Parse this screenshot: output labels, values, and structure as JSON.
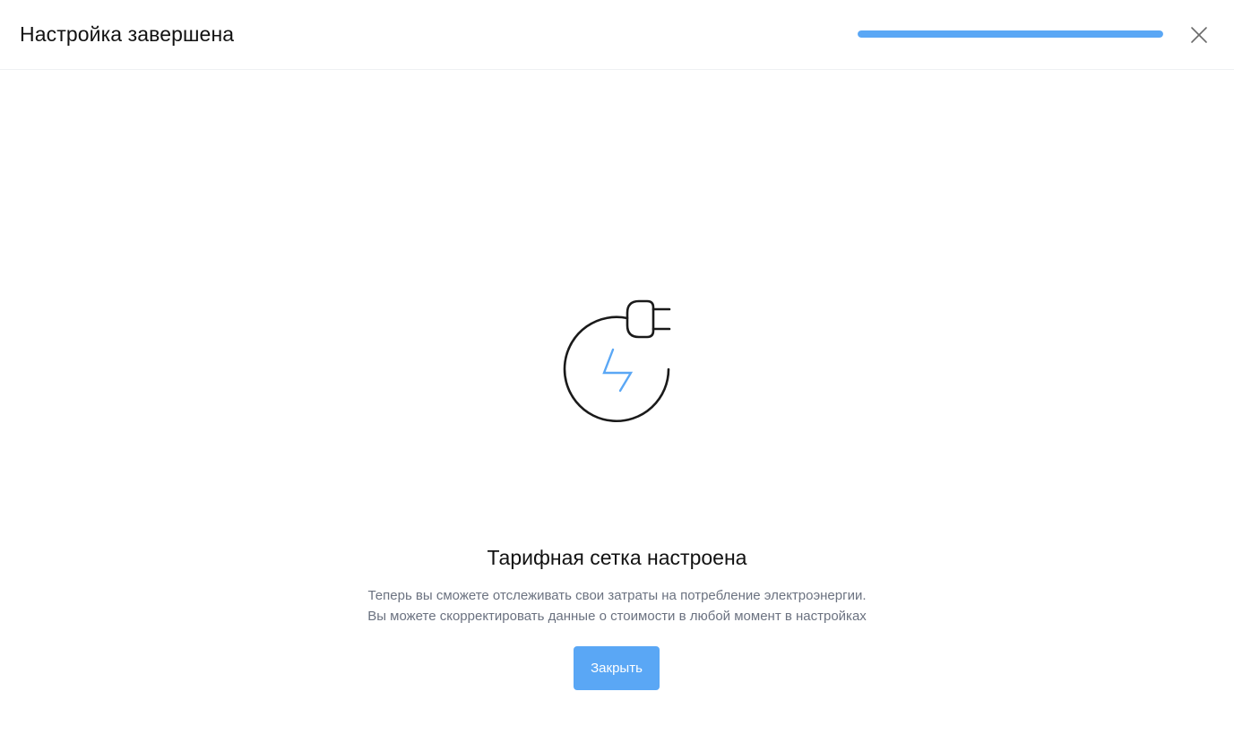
{
  "header": {
    "title": "Настройка завершена",
    "progress_fraction": 1.0,
    "close_icon": "close-icon"
  },
  "main": {
    "illustration_icon": "plug-lightning-icon",
    "title": "Тарифная сетка настроена",
    "description_line1": "Теперь вы сможете отслеживать свои затраты на потребление электроэнергии.",
    "description_line2": "Вы можете скорректировать данные о стоимости в любой момент в настройках",
    "close_button_label": "Закрыть"
  },
  "colors": {
    "accent": "#5aa7f5",
    "progress": "#5aa7f5",
    "button_bg": "#5aa7f5",
    "text_primary": "#121212",
    "text_secondary": "#6b7280",
    "icon_stroke": "#1a1a1a"
  }
}
